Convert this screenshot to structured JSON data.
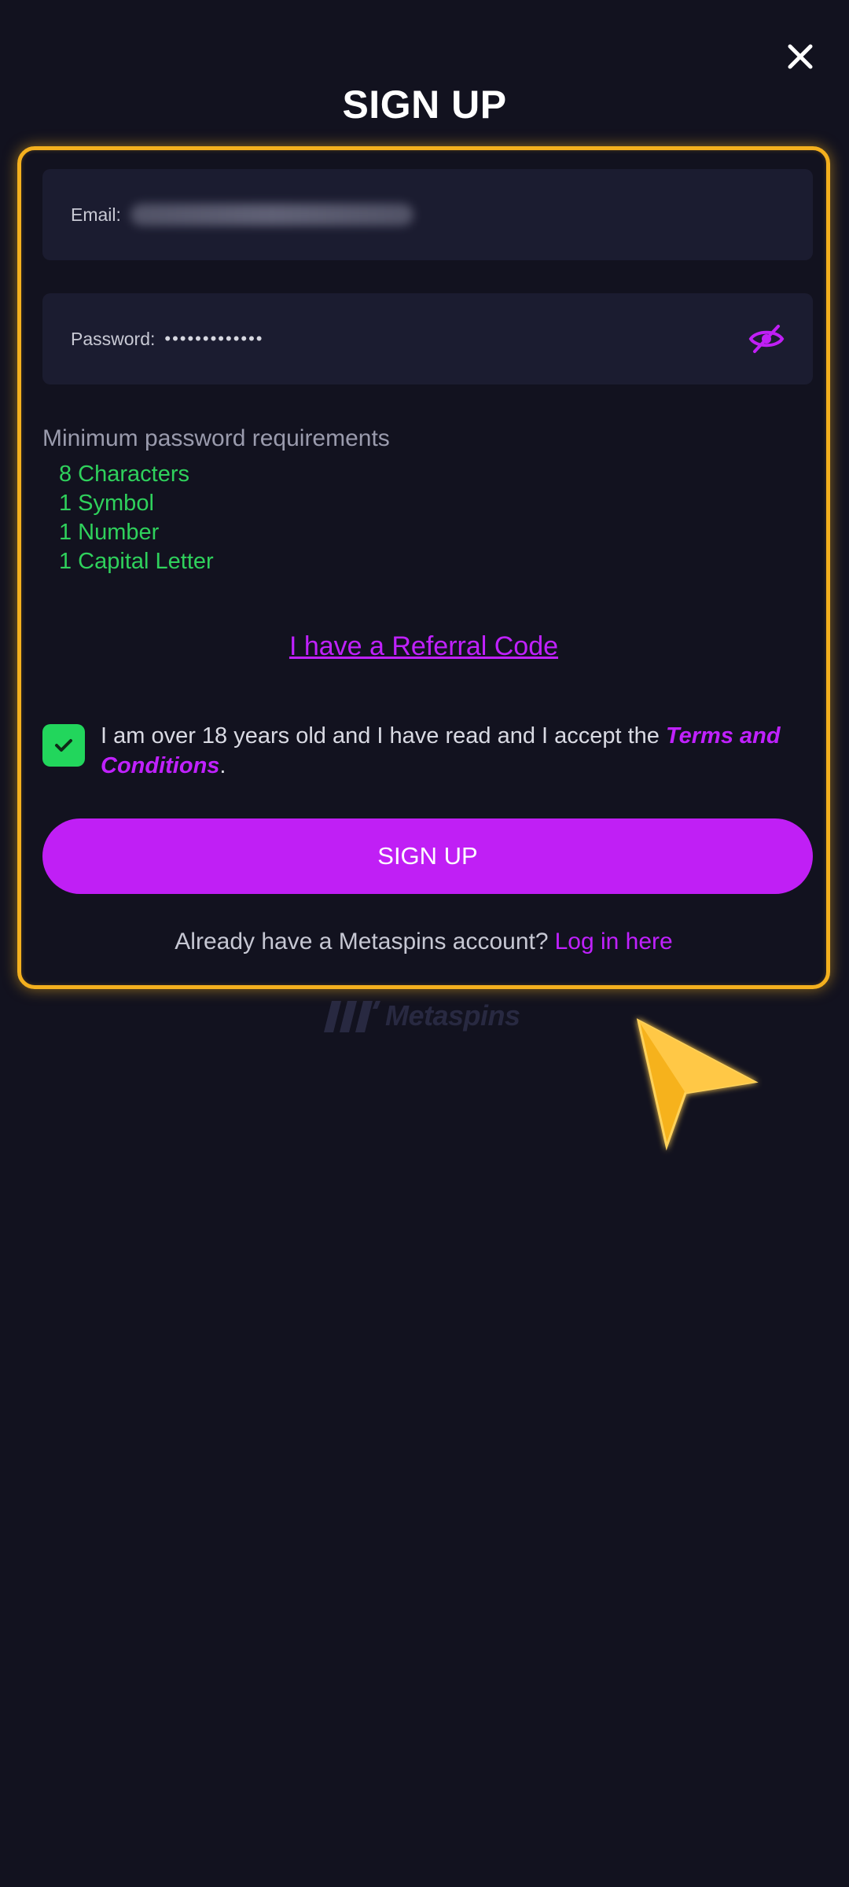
{
  "header": {
    "title": "SIGN UP",
    "close_icon": "close-icon"
  },
  "form": {
    "email_label": "Email:",
    "email_value_state": "blurred",
    "password_label": "Password:",
    "password_value": "•••••••••••••",
    "password_toggle_icon": "eye-off-icon",
    "requirements_title": "Minimum password requirements",
    "requirements": [
      "8 Characters",
      "1 Symbol",
      "1 Number",
      "1 Capital Letter"
    ],
    "referral_link": "I have a Referral Code",
    "consent_checked": true,
    "consent_text": "I am over 18 years old and I have read and I accept the ",
    "terms_link": "Terms and Conditions",
    "consent_suffix": ".",
    "submit_label": "SIGN UP",
    "login_prompt": "Already have a Metaspins account?",
    "login_link": "Log in here"
  },
  "brand": {
    "name": "Metaspins"
  },
  "colors": {
    "background": "#12121f",
    "field_bg": "#1b1c30",
    "accent_purple": "#c01ff5",
    "success_green": "#2fd15c",
    "highlight_yellow": "#f4b01e"
  }
}
